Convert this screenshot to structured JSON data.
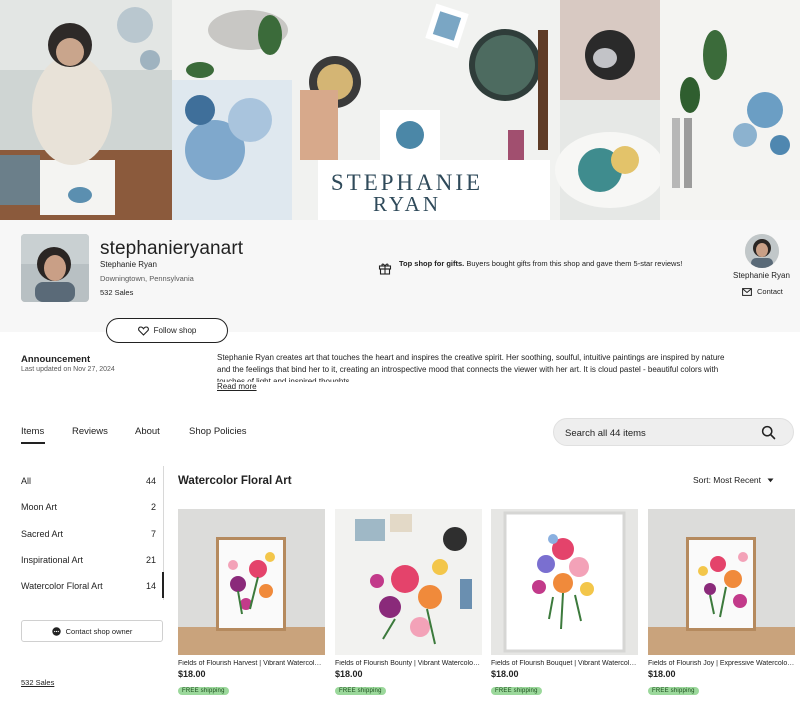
{
  "banner": {
    "brand_line1": "STEPHANIE",
    "brand_line2": "RYAN"
  },
  "shop": {
    "name": "stephanieryanart",
    "owner": "Stephanie Ryan",
    "location": "Downingtown, Pennsylvania",
    "sales": "532 Sales",
    "gift_bold": "Top shop for gifts.",
    "gift_text": " Buyers bought gifts from this shop and gave them 5-star reviews!",
    "contact_name": "Stephanie Ryan",
    "contact_label": "Contact",
    "follow_label": "Follow shop"
  },
  "announcement": {
    "title": "Announcement",
    "updated": "Last updated on Nov 27, 2024",
    "body": "Stephanie Ryan creates art that touches the heart and inspires the creative spirit. Her soothing, soulful, intuitive paintings are inspired by nature and the feelings that bind her to it, creating an introspective mood that connects the viewer with her art. It is cloud pastel - beautiful colors with touches of light and inspired thoughts.",
    "read_more": "Read more"
  },
  "tabs": [
    {
      "label": "Items"
    },
    {
      "label": "Reviews"
    },
    {
      "label": "About"
    },
    {
      "label": "Shop Policies"
    }
  ],
  "search": {
    "placeholder": "Search all 44 items"
  },
  "sidebar": {
    "items": [
      {
        "label": "All",
        "count": "44"
      },
      {
        "label": "Moon Art",
        "count": "2"
      },
      {
        "label": "Sacred Art",
        "count": "7"
      },
      {
        "label": "Inspirational Art",
        "count": "21"
      },
      {
        "label": "Watercolor Floral Art",
        "count": "14"
      }
    ],
    "contact_owner": "Contact shop owner",
    "sales_link": "532 Sales"
  },
  "section": {
    "title": "Watercolor Floral Art",
    "sort_label": "Sort: Most Recent"
  },
  "listings": [
    {
      "title": "Fields of Flourish Harvest | Vibrant Watercolor Floral Art",
      "price": "$18.00",
      "badge": "FREE shipping"
    },
    {
      "title": "Fields of Flourish Bounty | Vibrant Watercolor Floral Art",
      "price": "$18.00",
      "badge": "FREE shipping"
    },
    {
      "title": "Fields of Flourish Bouquet | Vibrant Watercolor Floral Art",
      "price": "$18.00",
      "badge": "FREE shipping"
    },
    {
      "title": "Fields of Flourish Joy | Expressive Watercolor Floral Art",
      "price": "$18.00",
      "badge": "FREE shipping"
    }
  ],
  "colors": {
    "badge_green": "#9bd89b",
    "text": "#222222",
    "header_band": "#f7f7f7",
    "search_bg": "#eeeeee"
  },
  "icons": [
    "gift-icon",
    "envelope-icon",
    "heart-icon",
    "search-icon",
    "chat-icon",
    "chevron-down-icon"
  ]
}
